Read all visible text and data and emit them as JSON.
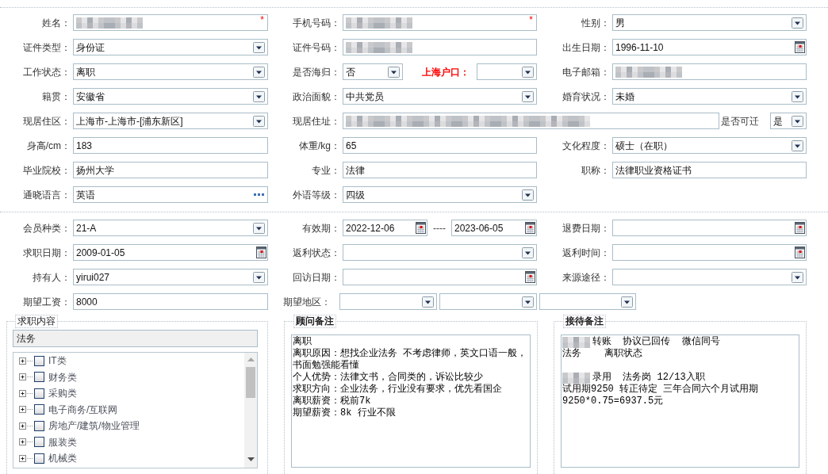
{
  "basic_info": [
    [
      {
        "kind": "text",
        "label": "姓名：",
        "redacted": true,
        "required_mark": "*"
      },
      {
        "kind": "text",
        "label": "手机号码：",
        "redacted": true,
        "required_mark": "*"
      },
      {
        "kind": "select",
        "label": "性别：",
        "value": "男"
      }
    ],
    [
      {
        "kind": "select",
        "label": "证件类型：",
        "value": "身份证"
      },
      {
        "kind": "text",
        "label": "证件号码：",
        "redacted": true
      },
      {
        "kind": "date",
        "label": "出生日期：",
        "value": "1996-11-10"
      }
    ],
    [
      {
        "kind": "select",
        "label": "工作状态：",
        "value": "离职"
      },
      {
        "kind": "select_pair",
        "label": "是否海归：",
        "value": "否",
        "second": {
          "label": "上海户口：",
          "color": "#ff0000"
        }
      },
      {
        "kind": "text",
        "label": "电子邮箱：",
        "redacted": true
      }
    ],
    [
      {
        "kind": "select",
        "label": "籍贯：",
        "value": "安徽省"
      },
      {
        "kind": "select",
        "label": "政治面貌：",
        "value": "中共党员"
      },
      {
        "kind": "select",
        "label": "婚育状况：",
        "value": "未婚"
      }
    ],
    [
      {
        "kind": "select",
        "label": "现居住区：",
        "value": "上海市-上海市-[浦东新区]"
      },
      {
        "kind": "wide_text",
        "label": "现居住址：",
        "redacted": true,
        "extra": {
          "label": "是否可迁",
          "value": "是"
        }
      }
    ],
    [
      {
        "kind": "text",
        "label": "身高/cm：",
        "value": "183",
        "redacted": false
      },
      {
        "kind": "text",
        "label": "体重/kg：",
        "value": "65",
        "redacted": false
      },
      {
        "kind": "select",
        "label": "文化程度：",
        "value": "硕士（在职）"
      }
    ],
    [
      {
        "kind": "text",
        "label": "毕业院校：",
        "value": "扬州大学",
        "redacted": false
      },
      {
        "kind": "text",
        "label": "专业：",
        "value": "法律",
        "redacted": false
      },
      {
        "kind": "text",
        "label": "职称：",
        "value": "法律职业资格证书",
        "redacted": false
      }
    ],
    [
      {
        "kind": "lookup",
        "label": "通晓语言：",
        "value": "英语"
      },
      {
        "kind": "select",
        "label": "外语等级：",
        "value": "四级"
      }
    ]
  ],
  "membership": [
    [
      {
        "kind": "select",
        "label": "会员种类：",
        "value": "21-A"
      },
      {
        "kind": "date_range",
        "label": "有效期：",
        "value": "2022-12-06",
        "separator": "----",
        "end_value": "2023-06-05"
      },
      {
        "kind": "date",
        "label": "退费日期："
      }
    ],
    [
      {
        "kind": "date",
        "label": "求职日期：",
        "value": "2009-01-05"
      },
      {
        "kind": "select",
        "label": "返利状态："
      },
      {
        "kind": "date",
        "label": "返利时间："
      }
    ],
    [
      {
        "kind": "select",
        "label": "持有人：",
        "value": "yirui027"
      },
      {
        "kind": "date",
        "label": "回访日期："
      },
      {
        "kind": "select",
        "label": "来源途径："
      }
    ],
    [
      {
        "kind": "text",
        "label": "期望工资：",
        "value": "8000",
        "redacted": false
      },
      {
        "kind": "region_picker",
        "label": "期望地区："
      }
    ]
  ],
  "panels": [
    {
      "kind": "category_tree",
      "legend": "求职内容",
      "selected_value": "法务",
      "items": [
        {
          "label": "IT类",
          "expanded": false,
          "checked": false
        },
        {
          "label": "财务类",
          "expanded": false,
          "checked": false
        },
        {
          "label": "采购类",
          "expanded": false,
          "checked": false
        },
        {
          "label": "电子商务/互联网",
          "expanded": false,
          "checked": false
        },
        {
          "label": "房地产/建筑/物业管理",
          "expanded": false,
          "checked": false
        },
        {
          "label": "服装类",
          "expanded": false,
          "checked": false
        },
        {
          "label": "机械类",
          "expanded": false,
          "checked": false
        }
      ]
    },
    {
      "kind": "notes",
      "legend": "顾问备注",
      "blocks": [
        {
          "lines": [
            {
              "text": "离职",
              "redacted": false
            },
            {
              "text": "离职原因：想找企业法务 不考虑律师，英文口语一般，",
              "redacted": false
            },
            {
              "text": "书面勉强能看懂",
              "redacted": false
            },
            {
              "text": "个人优势：法律文书，合同类的，诉讼比较少",
              "redacted": false
            },
            {
              "text": "求职方向：企业法务，行业没有要求，优先看国企",
              "redacted": false
            },
            {
              "text": "离职薪资：税前7k",
              "redacted": false
            },
            {
              "text": "期望薪资：8k 行业不限",
              "redacted": false
            }
          ]
        }
      ]
    },
    {
      "kind": "notes",
      "legend": "接待备注",
      "blocks": [
        {
          "lines": [
            {
              "text": "转账  协议已回传  微信同号",
              "redacted": true
            },
            {
              "text": "法务    离职状态",
              "redacted": false
            }
          ]
        },
        {
          "lines": [
            {
              "text": "录用  法务岗 12/13入职",
              "redacted": true
            },
            {
              "text": "试用期9250 转正待定 三年合同六个月试用期",
              "redacted": false
            },
            {
              "text": "9250*0.75=6937.5元",
              "redacted": false
            }
          ]
        }
      ]
    }
  ]
}
